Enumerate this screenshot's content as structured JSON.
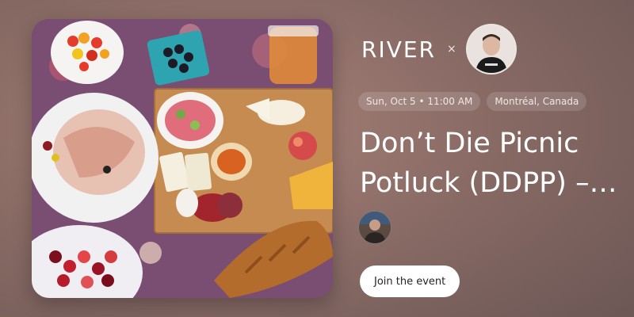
{
  "brand": {
    "name": "RIVER",
    "separator": "×"
  },
  "host": {
    "avatar_icon": "person-icon"
  },
  "event": {
    "date_chip": "Sun, Oct 5 • 11:00 AM",
    "location_chip": "Montréal, Canada",
    "title": "Don’t Die Picnic Potluck (DDPP) – Montréal"
  },
  "attendees": [
    {
      "avatar_icon": "person-icon"
    }
  ],
  "actions": {
    "join_label": "Join the event"
  },
  "photo": {
    "subject": "picnic spread"
  },
  "colors": {
    "button_bg": "#ffffff",
    "button_text": "#2a2322",
    "chip_bg": "rgba(255,255,255,0.14)"
  }
}
